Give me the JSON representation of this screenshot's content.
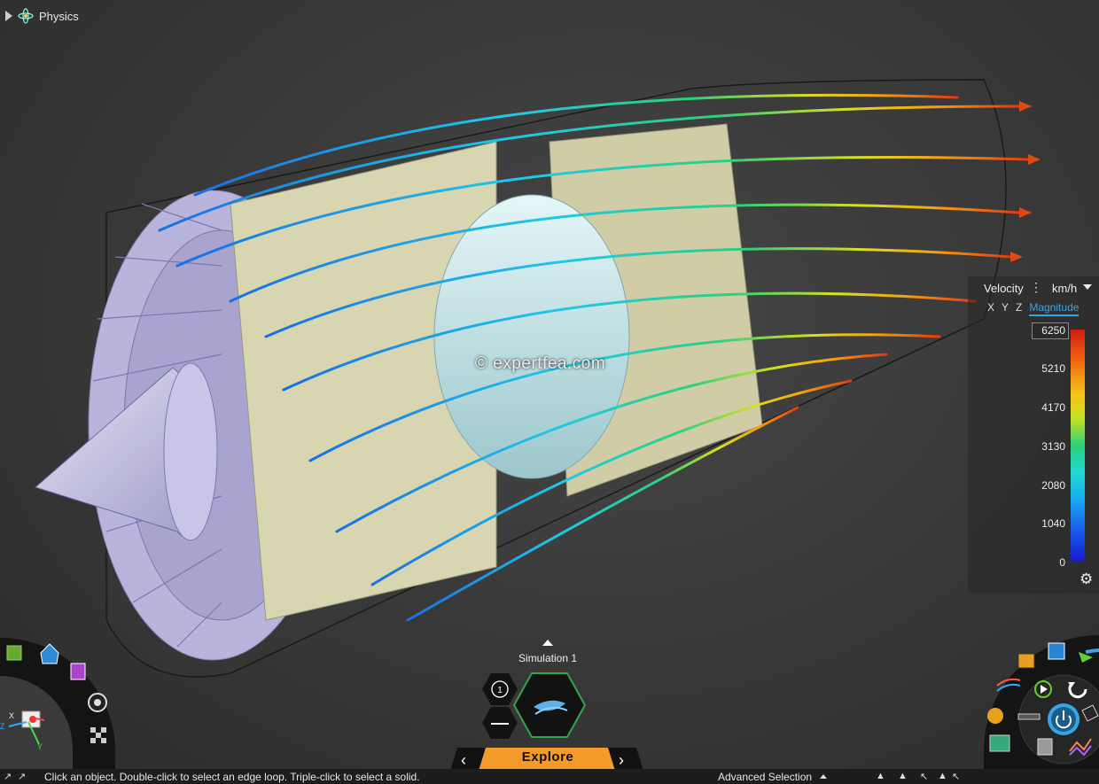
{
  "tree": {
    "node_label": "Physics",
    "icon": "physics-atom-icon"
  },
  "watermark": "© expertfea.com",
  "legend": {
    "title": "Velocity",
    "unit": "km/h",
    "components": [
      "X",
      "Y",
      "Z",
      "Magnitude"
    ],
    "active_component": "Magnitude",
    "ticks": [
      "6250",
      "5210",
      "4170",
      "3130",
      "2080",
      "1040",
      "0"
    ],
    "colors": {
      "max": "#d21a12",
      "mid": "#2ed07a",
      "min": "#1a1ad0"
    }
  },
  "simulation": {
    "label": "Simulation 1",
    "badge_count": "1",
    "mode": "Explore"
  },
  "status": {
    "hint": "Click an object. Double-click to select an edge loop. Triple-click to select a solid.",
    "advanced_selection": "Advanced Selection"
  },
  "triad": {
    "axes": [
      "Z",
      "X",
      "Y"
    ]
  },
  "colors": {
    "accent": "#35a7e6",
    "explore": "#f39a2b",
    "hex_border": "#2fa84a"
  }
}
